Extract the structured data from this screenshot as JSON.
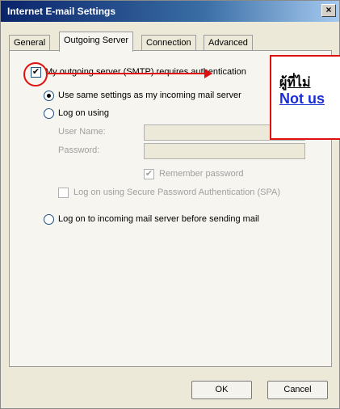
{
  "window": {
    "title": "Internet E-mail Settings",
    "close_label": "×"
  },
  "tabs": [
    {
      "label": "General"
    },
    {
      "label": "Outgoing Server"
    },
    {
      "label": "Connection"
    },
    {
      "label": "Advanced"
    }
  ],
  "outgoing": {
    "requires_auth_label": "My outgoing server (SMTP) requires authentication",
    "requires_auth_checked": true,
    "use_same_label": "Use same settings as my incoming mail server",
    "log_on_using_label": "Log on using",
    "user_name_label": "User Name:",
    "user_name_value": "",
    "password_label": "Password:",
    "password_value": "",
    "remember_password_label": "Remember password",
    "remember_password_checked": true,
    "spa_label": "Log on using Secure Password Authentication (SPA)",
    "spa_checked": false,
    "log_on_incoming_label": "Log on to incoming mail server before sending mail",
    "selected_option": "use_same"
  },
  "buttons": {
    "ok": "OK",
    "cancel": "Cancel"
  },
  "annotation": {
    "callout_line1": "ผู้ที่ไม่",
    "callout_line2": "Not us",
    "color": "#e01010",
    "link_color": "#1b2ed6"
  }
}
